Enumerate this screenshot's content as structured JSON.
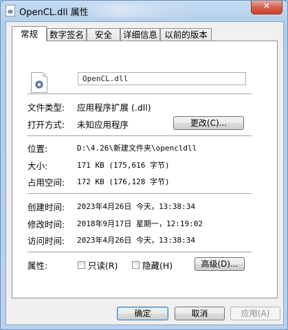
{
  "window": {
    "title": "OpenCL.dll 属性",
    "close_symbol": "✕"
  },
  "tabs": [
    "常规",
    "数字签名",
    "安全",
    "详细信息",
    "以前的版本"
  ],
  "general": {
    "file_name": "OpenCL.dll",
    "file_type_label": "文件类型:",
    "file_type_value": "应用程序扩展 (.dll)",
    "opens_with_label": "打开方式:",
    "opens_with_value": "未知应用程序",
    "change_button": "更改(C)...",
    "location_label": "位置:",
    "location_value": "D:\\4.26\\新建文件夹\\opencldll",
    "size_label": "大小:",
    "size_value": "171 KB (175,616 字节)",
    "size_on_disk_label": "占用空间:",
    "size_on_disk_value": "172 KB (176,128 字节)",
    "created_label": "创建时间:",
    "created_value": "2023年4月26日 今天，13:38:34",
    "modified_label": "修改时间:",
    "modified_value": "2018年9月17日 星期一，12:19:02",
    "accessed_label": "访问时间:",
    "accessed_value": "2023年4月26日 今天，13:38:34",
    "attributes_label": "属性:",
    "readonly_label": "只读(R)",
    "hidden_label": "隐藏(H)",
    "advanced_button": "高级(D)..."
  },
  "footer": {
    "ok": "确定",
    "cancel": "取消",
    "apply": "应用(A)"
  },
  "icons": {
    "title": "dll-file-icon",
    "file": "dll-file-icon",
    "close": "close-icon"
  }
}
